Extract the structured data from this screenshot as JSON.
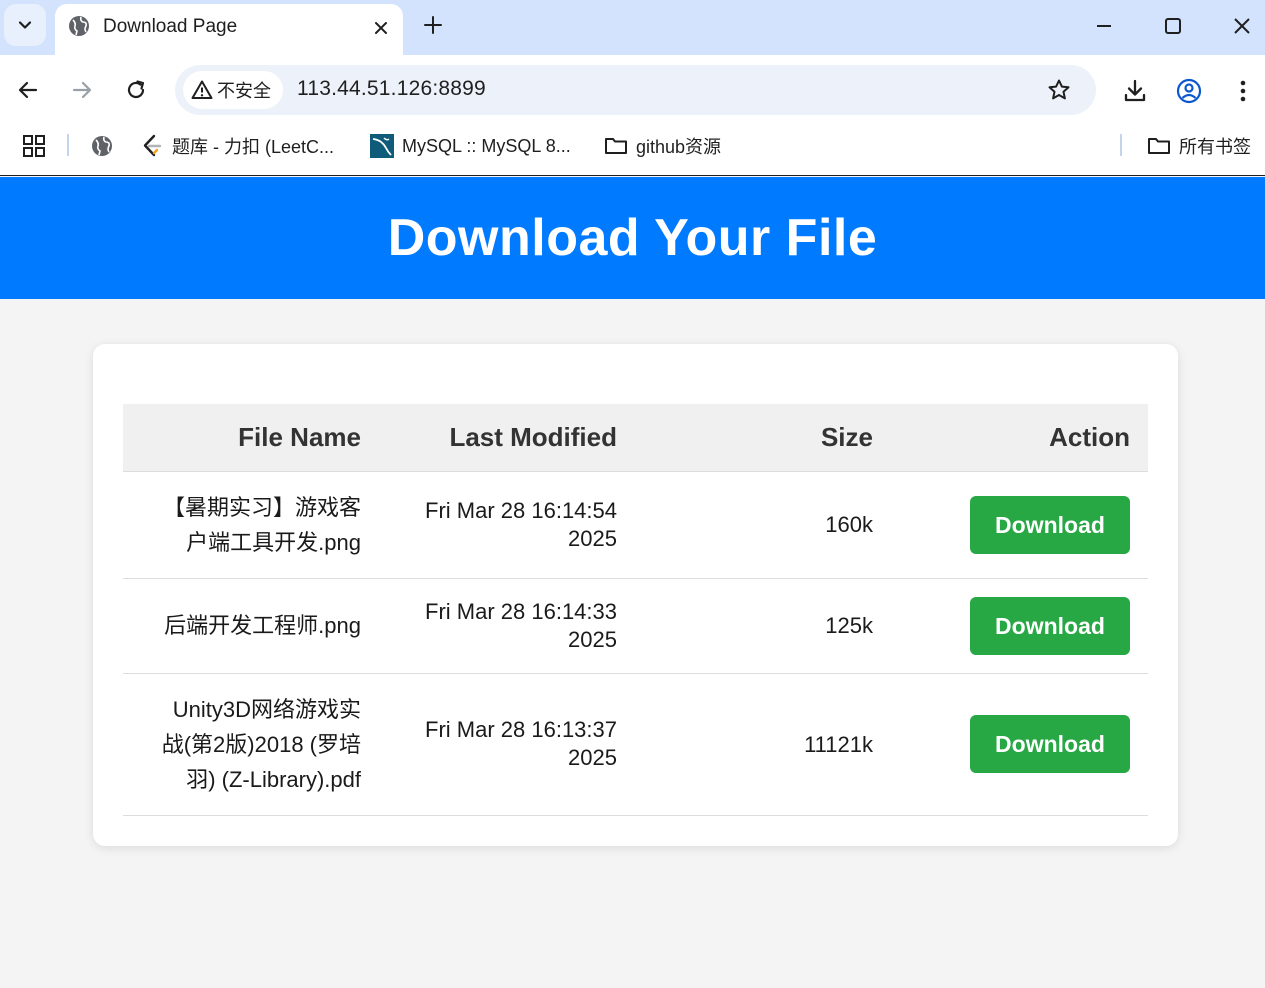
{
  "browser": {
    "tab_title": "Download Page",
    "security_label": "不安全",
    "url": "113.44.51.126:8899",
    "bookmarks": [
      {
        "label": "题库 - 力扣 (LeetC..."
      },
      {
        "label": "MySQL :: MySQL 8..."
      },
      {
        "label": "github资源"
      }
    ],
    "all_bookmarks_label": "所有书签"
  },
  "page": {
    "title": "Download Your File",
    "colors": {
      "header": "#007bff",
      "button": "#28a745"
    }
  },
  "table": {
    "headers": [
      "File Name",
      "Last Modified",
      "Size",
      "Action"
    ],
    "rows": [
      {
        "name_lines": [
          "【暑期实习】游戏客",
          "户端工具开发.png"
        ],
        "date_lines": [
          "Fri Mar 28 16:14:54",
          "2025"
        ],
        "size": "160k",
        "action": "Download"
      },
      {
        "name_lines": [
          "后端开发工程师.png"
        ],
        "date_lines": [
          "Fri Mar 28 16:14:33",
          "2025"
        ],
        "size": "125k",
        "action": "Download"
      },
      {
        "name_lines": [
          "Unity3D网络游戏实",
          "战(第2版)2018 (罗培",
          "羽) (Z-Library).pdf"
        ],
        "date_lines": [
          "Fri Mar 28 16:13:37",
          "2025"
        ],
        "size": "11121k",
        "action": "Download"
      }
    ]
  }
}
